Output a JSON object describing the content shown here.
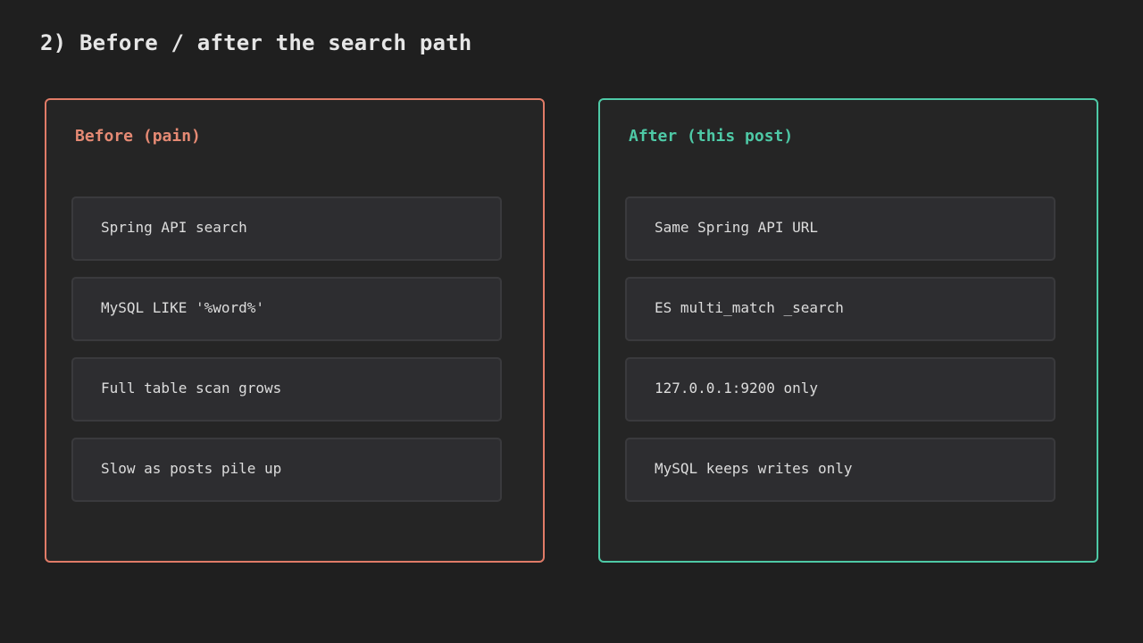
{
  "title": "2) Before / after the search path",
  "panels": {
    "before": {
      "heading": "Before (pain)",
      "steps": [
        "Spring API search",
        "MySQL LIKE '%word%'",
        "Full table scan grows",
        "Slow as posts pile up"
      ]
    },
    "after": {
      "heading": "After (this post)",
      "steps": [
        "Same Spring API URL",
        "ES multi_match _search",
        "127.0.0.1:9200 only",
        "MySQL keeps writes only"
      ]
    }
  },
  "colors": {
    "before_accent": "#e07b67",
    "after_accent": "#4ec9a6",
    "background": "#1f1f1f"
  }
}
